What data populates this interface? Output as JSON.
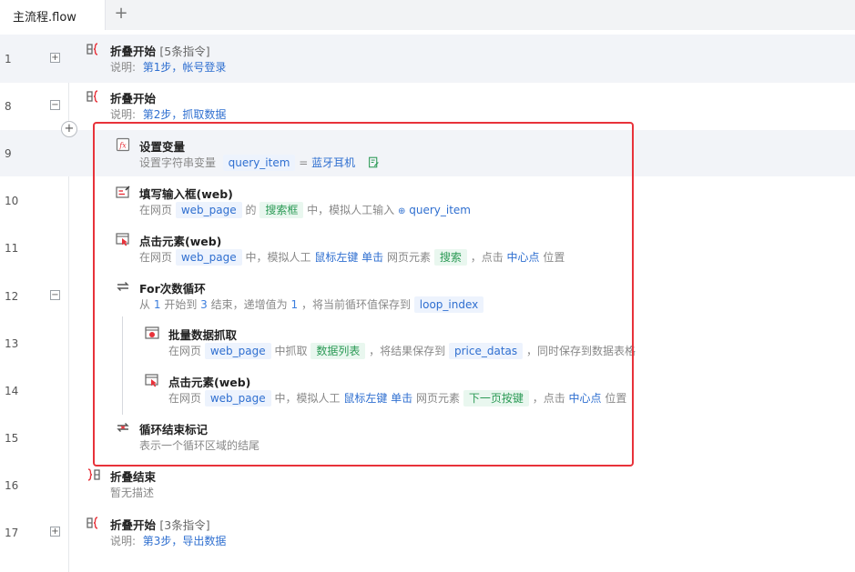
{
  "tab": {
    "name": "主流程.flow",
    "add": "+"
  },
  "rows": [
    {
      "line": "1",
      "fold": "+",
      "title": "折叠开始",
      "extra": "[5条指令]",
      "desc_prefix": "说明:",
      "desc_value": "第1步，帐号登录"
    },
    {
      "line": "8",
      "fold": "−",
      "title": "折叠开始",
      "desc_prefix": "说明:",
      "desc_value": "第2步，抓取数据"
    },
    {
      "line": "9",
      "title": "设置变量",
      "d1": "设置字符串变量",
      "var": "query_item",
      "eq": "=",
      "value": "蓝牙耳机"
    },
    {
      "line": "10",
      "title": "填写输入框(web)",
      "d1": "在网页",
      "page": "web_page",
      "d2": "的",
      "element": "搜索框",
      "d3": "中，模拟人工输入",
      "var": "query_item"
    },
    {
      "line": "11",
      "title": "点击元素(web)",
      "d1": "在网页",
      "page": "web_page",
      "d2": "中，模拟人工",
      "button": "鼠标左键",
      "action": "单击",
      "d3": "网页元素",
      "element": "搜索",
      "d4": "，点击",
      "pos": "中心点",
      "d5": "位置"
    },
    {
      "line": "12",
      "fold": "−",
      "title": "For次数循环",
      "d1": "从",
      "start": "1",
      "d2": "开始到",
      "end": "3",
      "d3": "结束，递增值为",
      "step": "1",
      "d4": "，将当前循环值保存到",
      "var": "loop_index"
    },
    {
      "line": "13",
      "title": "批量数据抓取",
      "d1": "在网页",
      "page": "web_page",
      "d2": "中抓取",
      "element": "数据列表",
      "d3": "，将结果保存到",
      "var": "price_datas",
      "d4": "，同时保存到数据表格"
    },
    {
      "line": "14",
      "title": "点击元素(web)",
      "d1": "在网页",
      "page": "web_page",
      "d2": "中，模拟人工",
      "button": "鼠标左键",
      "action": "单击",
      "d3": "网页元素",
      "element": "下一页按键",
      "d4": "，点击",
      "pos": "中心点",
      "d5": "位置"
    },
    {
      "line": "15",
      "title": "循环结束标记",
      "desc": "表示一个循环区域的结尾"
    },
    {
      "line": "16",
      "title": "折叠结束",
      "desc": "暂无描述"
    },
    {
      "line": "17",
      "fold": "+",
      "title": "折叠开始",
      "extra": "[3条指令]",
      "desc_prefix": "说明:",
      "desc_value": "第3步，导出数据"
    }
  ],
  "add_step": "+",
  "colors": {
    "highlight": "#f2f4f8",
    "red_box": "#e8323a",
    "link_blue": "#2f6fd0",
    "element_green": "#2b9a55"
  }
}
